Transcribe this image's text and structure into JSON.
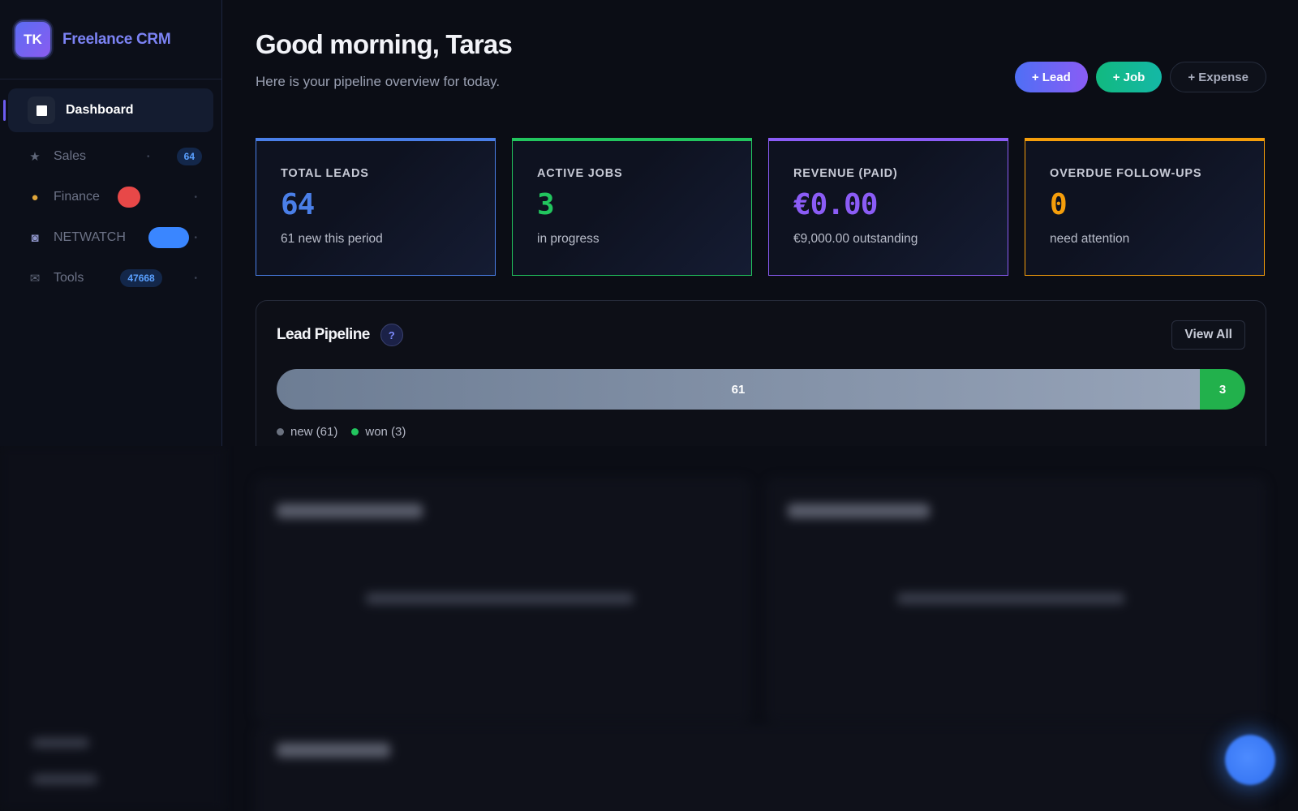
{
  "brand": {
    "initials": "TK",
    "name": "Freelance CRM"
  },
  "sidebar": {
    "items": [
      {
        "label": "Dashboard",
        "icon": "dashboard-square-icon",
        "active": true
      },
      {
        "label": "Sales",
        "icon": "star-icon",
        "badge": "64"
      },
      {
        "label": "Finance",
        "icon": "money-bag-icon",
        "badge_color": "#e84848"
      },
      {
        "label": "NETWATCH",
        "icon": "robot-icon",
        "badge_color": "#3a86ff"
      },
      {
        "label": "Tools",
        "icon": "mail-icon",
        "badge": "47668"
      }
    ]
  },
  "header": {
    "greeting": "Good morning, Taras",
    "subtitle": "Here is your pipeline overview for today.",
    "actions": {
      "lead": "+ Lead",
      "job": "+ Job",
      "expense": "+ Expense"
    }
  },
  "stats": [
    {
      "label": "TOTAL LEADS",
      "value": "64",
      "sub": "61 new this period",
      "color": "#4a7fe8"
    },
    {
      "label": "ACTIVE JOBS",
      "value": "3",
      "sub": "in progress",
      "color": "#22c55e"
    },
    {
      "label": "REVENUE (PAID)",
      "value": "€0.00",
      "sub": "€9,000.00 outstanding",
      "color": "#8b5cf6"
    },
    {
      "label": "OVERDUE FOLLOW-UPS",
      "value": "0",
      "sub": "need attention",
      "color": "#f59e0b"
    }
  ],
  "pipeline": {
    "title": "Lead Pipeline",
    "help": "?",
    "view_all": "View All",
    "segments": [
      {
        "key": "new",
        "count": 61,
        "label": "61",
        "color": "#6b7280",
        "legend": "new (61)"
      },
      {
        "key": "won",
        "count": 3,
        "label": "3",
        "color": "#22c55e",
        "legend": "won (3)"
      }
    ]
  }
}
